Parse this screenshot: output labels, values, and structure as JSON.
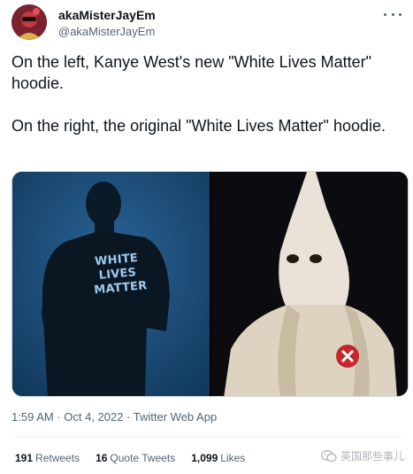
{
  "author": {
    "display_name": "akaMisterJayEm",
    "handle": "@akaMisterJayEm"
  },
  "tweet": {
    "paragraphs": [
      "On the left, Kanye West's new \"White Lives Matter\" hoodie.",
      "On the right, the original \"White Lives Matter\" hoodie."
    ]
  },
  "media": {
    "left_image_text": [
      "WHITE",
      "LIVES",
      "MATTER"
    ],
    "left_icon": "hoodie-photo",
    "right_icon": "robe-photo"
  },
  "meta": {
    "timestamp": "1:59 AM · Oct 4, 2022 · Twitter Web App"
  },
  "stats": {
    "retweets_count": "191",
    "retweets_label": "Retweets",
    "quotes_count": "16",
    "quotes_label": "Quote Tweets",
    "likes_count": "1,099",
    "likes_label": "Likes"
  },
  "watermark": {
    "icon": "wechat-icon",
    "text": "英国那些事儿"
  },
  "colors": {
    "text": "#0f1419",
    "secondary": "#536471",
    "divider": "#eff3f4"
  }
}
